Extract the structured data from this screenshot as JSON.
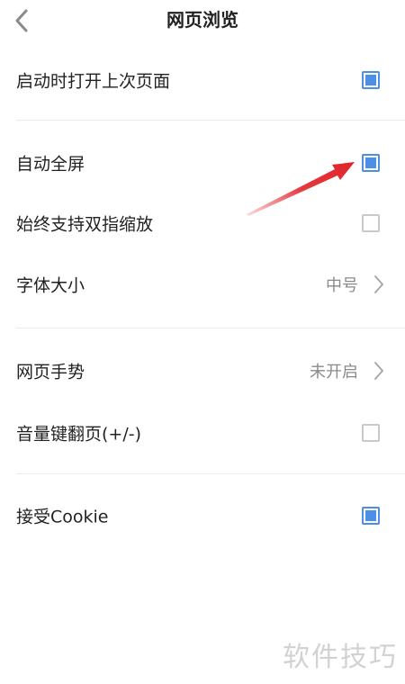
{
  "header": {
    "title": "网页浏览",
    "back_icon": "chevron-left-icon"
  },
  "settings": {
    "open_last_page": {
      "label": "启动时打开上次页面",
      "checked": true
    },
    "auto_fullscreen": {
      "label": "自动全屏",
      "checked": true
    },
    "pinch_zoom": {
      "label": "始终支持双指缩放",
      "checked": false
    },
    "font_size": {
      "label": "字体大小",
      "value": "中号"
    },
    "web_gestures": {
      "label": "网页手势",
      "value": "未开启"
    },
    "volume_key_page": {
      "label": "音量键翻页(+/-)",
      "checked": false
    },
    "accept_cookie": {
      "label": "接受Cookie",
      "checked": true
    }
  },
  "watermark": "软件技巧",
  "colors": {
    "accent": "#4b8fe6",
    "annotation_arrow": "#e0242a",
    "divider": "#ececec"
  }
}
